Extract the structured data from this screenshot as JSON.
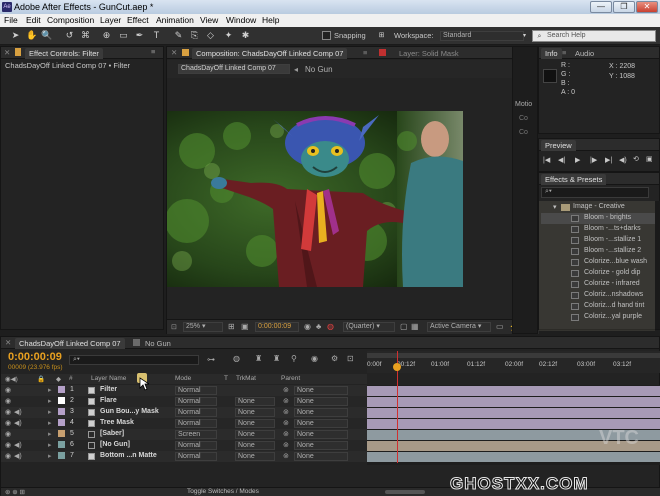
{
  "window": {
    "title": "Adobe After Effects - GunCut.aep *",
    "controls": [
      "—",
      "❐",
      "✕"
    ]
  },
  "menu": [
    "File",
    "Edit",
    "Composition",
    "Layer",
    "Effect",
    "Animation",
    "View",
    "Window",
    "Help"
  ],
  "toolbar": {
    "snapping": "Snapping",
    "workspace_label": "Workspace:",
    "workspace_value": "Standard",
    "search_placeholder": "Search Help"
  },
  "effect_controls": {
    "tab": "Effect Controls: Filter",
    "subtitle": "ChadsDayOff Linked Comp 07 • Filter"
  },
  "composition": {
    "tab": "Composition: ChadsDayOff Linked Comp 07",
    "layer_tab": "Layer: Solid Mask",
    "subtabs": [
      "ChadsDayOff Linked Comp 07",
      "No Gun"
    ],
    "zoom": "25%",
    "timecode": "0:00:00:09",
    "resolution": "(Quarter)",
    "camera": "Active Camera"
  },
  "info": {
    "tabs": [
      "Info",
      "Audio"
    ],
    "channels": [
      "R :",
      "G :",
      "B :",
      "A : 0"
    ],
    "x": "X : 2208",
    "y": "Y : 1088",
    "side_labels": [
      "Motio",
      "Co",
      "Co"
    ]
  },
  "preview": {
    "tab": "Preview",
    "buttons": [
      "|◀",
      "◀|",
      "▶",
      "|▶",
      "▶|",
      "◀)",
      "⟲",
      "▣"
    ]
  },
  "effects_presets": {
    "tab": "Effects & Presets",
    "folder": "Image - Creative",
    "items": [
      "Bloom - brights",
      "Bloom -...ts+darks",
      "Bloom -...stallize 1",
      "Bloom -...stallize 2",
      "Colorize...blue wash",
      "Colorize - gold dip",
      "Colorize - infrared",
      "Coloriz...nshadows",
      "Coloriz...d hand tint",
      "Coloriz...yal purple"
    ]
  },
  "timeline": {
    "tabs": [
      "ChadsDayOff Linked Comp 07",
      "No Gun"
    ],
    "timecode": "0:00:00:09",
    "frame_info": "00009 (23.976 fps)",
    "search_placeholder": "",
    "columns": {
      "num": "#",
      "layer_name": "Layer Name",
      "mode": "Mode",
      "t": "T",
      "trkmat": "TrkMat",
      "parent": "Parent"
    },
    "ruler": [
      "0:00f",
      "00:12f",
      "01:00f",
      "01:12f",
      "02:00f",
      "02:12f",
      "03:00f",
      "03:12f"
    ],
    "playhead_fraction": 0.102,
    "layers": [
      {
        "num": "1",
        "name": "Filter",
        "bracket": false,
        "color": "#b4a0c8",
        "bar": "#a79ab6",
        "mode": "Normal",
        "trkmat": "",
        "parent": "None",
        "audio": false
      },
      {
        "num": "2",
        "name": "Flare",
        "bracket": false,
        "color": "#ffffff",
        "bar": "#a79ab6",
        "mode": "Normal",
        "trkmat": "None",
        "parent": "None",
        "audio": false
      },
      {
        "num": "3",
        "name": "Gun Bou...y Mask",
        "bracket": false,
        "color": "#b4a0c8",
        "bar": "#a79ab6",
        "mode": "Normal",
        "trkmat": "None",
        "parent": "None",
        "audio": true
      },
      {
        "num": "4",
        "name": "Tree Mask",
        "bracket": false,
        "color": "#b4a0c8",
        "bar": "#a79ab6",
        "mode": "Normal",
        "trkmat": "None",
        "parent": "None",
        "audio": true
      },
      {
        "num": "5",
        "name": "[Saber]",
        "bracket": true,
        "color": "#c8a070",
        "bar": "#8e9aa0",
        "mode": "Screen",
        "trkmat": "None",
        "parent": "None",
        "audio": false
      },
      {
        "num": "6",
        "name": "[No Gun]",
        "bracket": true,
        "color": "#7aa0a0",
        "bar": "#a89a88",
        "mode": "Normal",
        "trkmat": "None",
        "parent": "None",
        "audio": true
      },
      {
        "num": "7",
        "name": "Bottom ...n Matte",
        "bracket": false,
        "color": "#7aa0a0",
        "bar": "#8e9aa0",
        "mode": "Normal",
        "trkmat": "None",
        "parent": "None",
        "audio": true
      }
    ],
    "toggle_label": "Toggle Switches / Modes"
  },
  "watermarks": {
    "vtc": "VTC",
    "site": "GHOSTXX.COM"
  },
  "colors": {
    "accent_orange": "#e8a020",
    "playhead": "#d03030"
  }
}
